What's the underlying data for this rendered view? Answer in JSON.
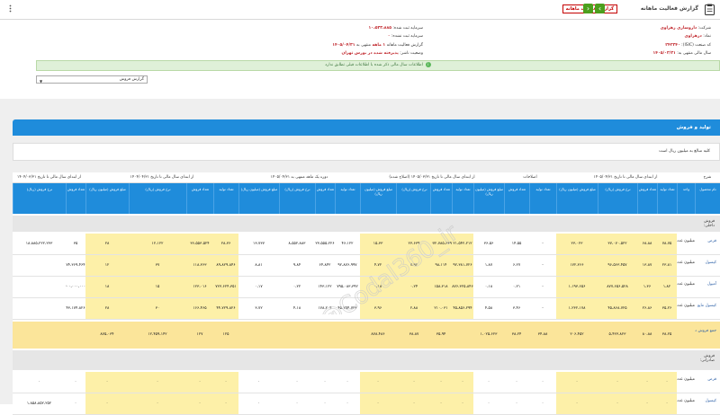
{
  "header": {
    "title": "گزارش فعالیت ماهانه",
    "badge": "گزارش فعالیت ماهانه",
    "prev": "‹",
    "next": "›"
  },
  "info": {
    "company_label": "شرکت:",
    "company": "داروسازی زهراوی",
    "symbol_label": "نماد:",
    "symbol": "دزهراوی",
    "isic_label": "کد صنعت (ISIC):",
    "isic": "۲۴۲۳۴۰",
    "fiscal_label": "سال مالی منتهی به:",
    "fiscal": "۱۴۰۵/۰۳/۳۱",
    "capital_label": "سرمایه ثبت شده:",
    "capital": "۱۰،۵۳۳،۸۸۵",
    "unreg_capital_label": "سرمایه ثبت نشده:",
    "unreg_capital": "۰",
    "report_label": "گزارش فعالیت ماهانه",
    "report_months": "۱ ماهه",
    "period_label": "منتهی به",
    "period_end": "۱۴۰۵/۰۴/۳۱",
    "status_label": "وضعیت ناشر:",
    "status": "پذیرفته شده در بورس تهران"
  },
  "success_message": "اطلاعات سال مالی ذکر شده با اطلاعات قبلی تطابق ندارد",
  "select": {
    "value": "گزارش فروش"
  },
  "section": {
    "title": "تولید و فروش",
    "note": "کلیه مبالغ به میلیون ریال است"
  },
  "table": {
    "group_headers": [
      "شرح",
      "اصلاحات",
      "از ابتدای سال مالی تا تاریخ ۱۴۰۵/۰۴/۳۱",
      "از ابتدای سال مالی تا تاریخ ۱۴۰۵/۰۳/۳۱ (اصلاح شده)",
      "دوره یک ماهه منتهی به ۱۴۰۵/۰۴/۳۱",
      "از ابتدای سال مالی تا تاریخ ۱۴۰۴/۰۴/۳۱",
      "از ابتدای سال مالی تا تاریخ ۱۴۰۴/۰۳/۳۱"
    ],
    "columns": [
      "نام محصول",
      "واحد",
      "تعداد تولید",
      "تعداد فروش",
      "نرخ فروش (ریال)",
      "مبلغ فروش (میلیون ریال)",
      "تعداد تولید",
      "تعداد فروش",
      "مبلغ فروش (میلیون ریال)",
      "تعداد تولید",
      "تعداد فروش",
      "نرخ فروش (ریال)",
      "مبلغ فروش (میلیون ریال)",
      "تعداد تولید",
      "تعداد فروش",
      "نرخ فروش (ریال)",
      "مبلغ فروش (میلیون ریال)",
      "تعداد تولید",
      "تعداد فروش",
      "نرخ فروش (ریال)",
      "مبلغ فروش (میلیون ریال)",
      "تعداد فروش",
      "نرخ فروش (ریال)"
    ],
    "section_domestic": "فروش داخلی:",
    "section_export": "فروش صادراتی:",
    "rows": [
      {
        "name": "قرص",
        "unit": "میلیون عدد",
        "c": [
          "۷۸،۷۵",
          "۶۸،۸۸",
          "۳۷،۰۷۰،۵۲۲",
          "۲۳،۰۲۳",
          "-",
          "۱۴،۵۵",
          "۳۶،۵۶",
          "۲۱،۵۴۲،۲۱۲",
          "۳۱،۴۷۲،۷۸۵،۶۳۹",
          "۲۳،۶۳۹",
          "۱۵،۳۳",
          "۴۶،۱۲۲",
          "۲۳،۵۵۵،۲۲۶",
          "۸،۵۵۲،۸۸۳",
          "۱۳،۷۳۷",
          "۲۸،۳۶",
          "۳۶،۵۵۳،۵۲۴",
          "۱۲،۱۲۲",
          "۲۸",
          "۳۵",
          "۱۸،۸۸۵،۲۲۲،۲۳۳"
        ]
      },
      {
        "name": "کپسول",
        "unit": "میلیون عدد",
        "c": [
          "۲۳،۸۱",
          "۱۳،۸۷",
          "۹۶،۵۶۳،۴۵۷",
          "۱۷۲،۳۶۶",
          "-",
          "۶،۲۷",
          "۱،۸۷",
          "۹۲،۳۸۱،۷۲۶",
          "۹۸،۱۱۴",
          "۷،۹۲",
          "۴،۷۲",
          "۹۲،۸۷۶،۹۹۷",
          "۶۴،۸۴۲",
          "۹،۸۴",
          "۸،۸۱",
          "۸۹،۸۲۹،۸۴۶",
          "۱۱۸،۳۶۳",
          "۳۷",
          "۱۲",
          "۷۴،۳۶۹،۴۶۴"
        ]
      },
      {
        "name": "آمپول",
        "unit": "میلیون عدد",
        "c": [
          "۱،۸۲",
          "۱،۳۶",
          "۸۷۷،۶۵۶،۵۲۸",
          "۱،۱۹۳،۶۵۶",
          "-",
          "۰،۲۱",
          "۰،۱۸",
          "۸۷۶،۳۲۵،۸۴۶",
          "۱۵۸،۳۱۸",
          "۰،۲۴",
          "۰،۱۸",
          "۷۹۵،۰۸۳،۳۹۲",
          "۱۴۳،۱۲۲",
          "۰،۲۲",
          "۰،۱۷",
          "۷۲۳،۶۲۴،۳۵۱",
          "۱۲۳،۰۱۶",
          "۱۵",
          "۱۸",
          "۶۰۰،۰۰۰،۰۰۰"
        ]
      },
      {
        "name": "کپسول مایع",
        "unit": "میلیون عدد",
        "c": [
          "۳۵،۲۶",
          "۲۶،۸۶",
          "۴۵،۸۶۸،۷۲۵",
          "۱،۲۳۲،۱۷۸",
          "-",
          "۳،۴۶",
          "۴،۵۸",
          "۴۵،۸۵۶،۲۹۴",
          "۲۱۰،۰۳۱",
          "۲،۸۸",
          "۳،۹۶",
          "۴۵،۲۵۴،۷۲۳",
          "۱۷۸،۲۰۴",
          "۴،۱۸",
          "۳،۷۲",
          "۴۴،۷۲۹،۸۲۶",
          "۱۶۶،۴۶۵",
          "۳۰",
          "۲۸",
          "۴۳،۱۷۴،۸۲۶"
        ]
      }
    ],
    "total_label": "جمع فروش داخلی",
    "total": [
      "۲۰۶،۴۵۲",
      "۵،۴۲۳،۸۲۳",
      "۸۰،۸۸",
      "۳۸،۲۵",
      "۱،۰۲۵،۶۲۳",
      "۳۸،۲۴",
      "۳۴،۸۸",
      "۸۷۸،۴۸۶",
      "۳۸،۸۷",
      "۳۵،۹۴",
      "۸۷۵،۰۳۴",
      "۱۲،۴۵۹،۱۴۲",
      "۱۲۷",
      "۱۲۵"
    ],
    "export_rows": [
      {
        "name": "قرص",
        "unit": "میلیون عدد",
        "v": "۰"
      },
      {
        "name": "کپسول",
        "unit": "میلیون عدد",
        "v": "۰"
      }
    ],
    "export_big": "۱،۸۵۸،۸۵۲،۲۵۲"
  },
  "watermark": "@Codal360_ir"
}
